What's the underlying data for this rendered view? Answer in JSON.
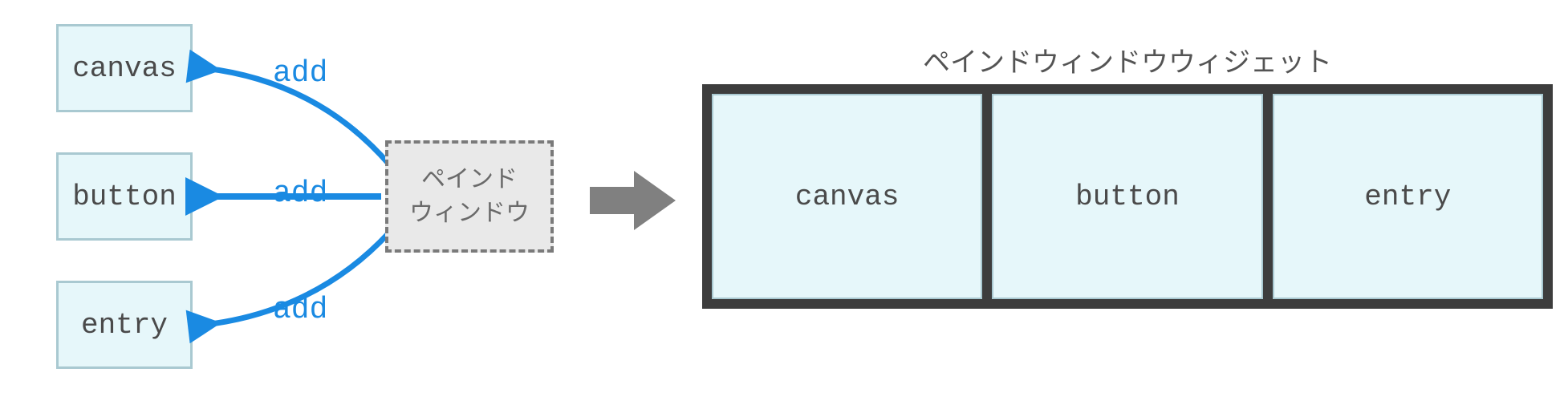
{
  "widgets": {
    "canvas": "canvas",
    "button": "button",
    "entry": "entry"
  },
  "operation_label": "add",
  "source_box_label": "ペインド\nウィンドウ",
  "result_title": "ペインドウィンドウウィジェット",
  "panes": [
    "canvas",
    "button",
    "entry"
  ],
  "colors": {
    "box_fill": "#e6f7fa",
    "box_border": "#a9c9d1",
    "accent_blue": "#1a8ae2",
    "frame_dark": "#3d3d3d",
    "dashed_grey": "#7a7a7a",
    "arrow_grey": "#808080"
  }
}
